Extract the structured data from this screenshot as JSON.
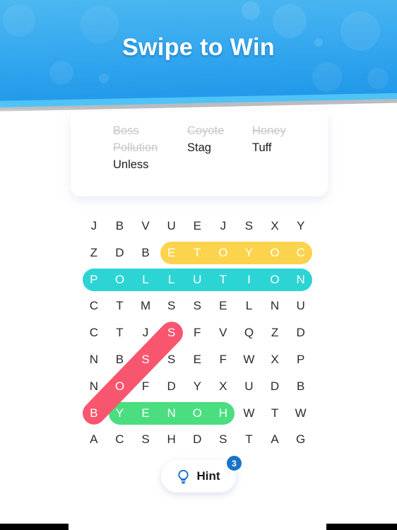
{
  "header": {
    "title": "Swipe to Win",
    "bg_from": "#4db8f0",
    "bg_to": "#1e96e8"
  },
  "word_list": {
    "words": [
      {
        "text": "Boss",
        "found": true
      },
      {
        "text": "Coyote",
        "found": true
      },
      {
        "text": "Honey",
        "found": true
      },
      {
        "text": "Pollution",
        "found": true
      },
      {
        "text": "Stag",
        "found": false
      },
      {
        "text": "Tuff",
        "found": false
      },
      {
        "text": "Unless",
        "found": false
      }
    ]
  },
  "puzzle": {
    "rows": 9,
    "cols": 9,
    "letters": [
      [
        "J",
        "B",
        "V",
        "U",
        "E",
        "J",
        "S",
        "X",
        "Y"
      ],
      [
        "Z",
        "D",
        "B",
        "E",
        "T",
        "O",
        "Y",
        "O",
        "C"
      ],
      [
        "P",
        "O",
        "L",
        "L",
        "U",
        "T",
        "I",
        "O",
        "N"
      ],
      [
        "C",
        "T",
        "M",
        "S",
        "S",
        "E",
        "L",
        "N",
        "U"
      ],
      [
        "C",
        "T",
        "J",
        "S",
        "F",
        "V",
        "Q",
        "Z",
        "D"
      ],
      [
        "N",
        "B",
        "S",
        "S",
        "E",
        "F",
        "W",
        "X",
        "P"
      ],
      [
        "N",
        "O",
        "F",
        "D",
        "Y",
        "X",
        "U",
        "D",
        "B"
      ],
      [
        "B",
        "Y",
        "E",
        "N",
        "O",
        "H",
        "W",
        "T",
        "W"
      ],
      [
        "A",
        "C",
        "S",
        "H",
        "D",
        "S",
        "T",
        "A",
        "G"
      ]
    ],
    "highlights": [
      {
        "word": "Coyote",
        "display": "ETOYOC",
        "color": "#fcd34d",
        "orientation": "horizontal",
        "row": 1,
        "col_start": 3,
        "col_end": 8
      },
      {
        "word": "Pollution",
        "display": "POLLUTION",
        "color": "#2dd4d4",
        "orientation": "horizontal",
        "row": 2,
        "col_start": 0,
        "col_end": 8
      },
      {
        "word": "Honey",
        "display": "YENOH",
        "color": "#4ade80",
        "orientation": "horizontal",
        "row": 7,
        "col_start": 1,
        "col_end": 5
      },
      {
        "word": "Boss",
        "display": "BOSS",
        "color": "#f8566f",
        "orientation": "diagonal-up-right",
        "row_start": 7,
        "col_start": 0,
        "row_end": 4,
        "col_end": 3
      }
    ]
  },
  "hint": {
    "label": "Hint",
    "count": "3",
    "icon": "lightbulb-icon",
    "badge_color": "#1a73c8"
  }
}
